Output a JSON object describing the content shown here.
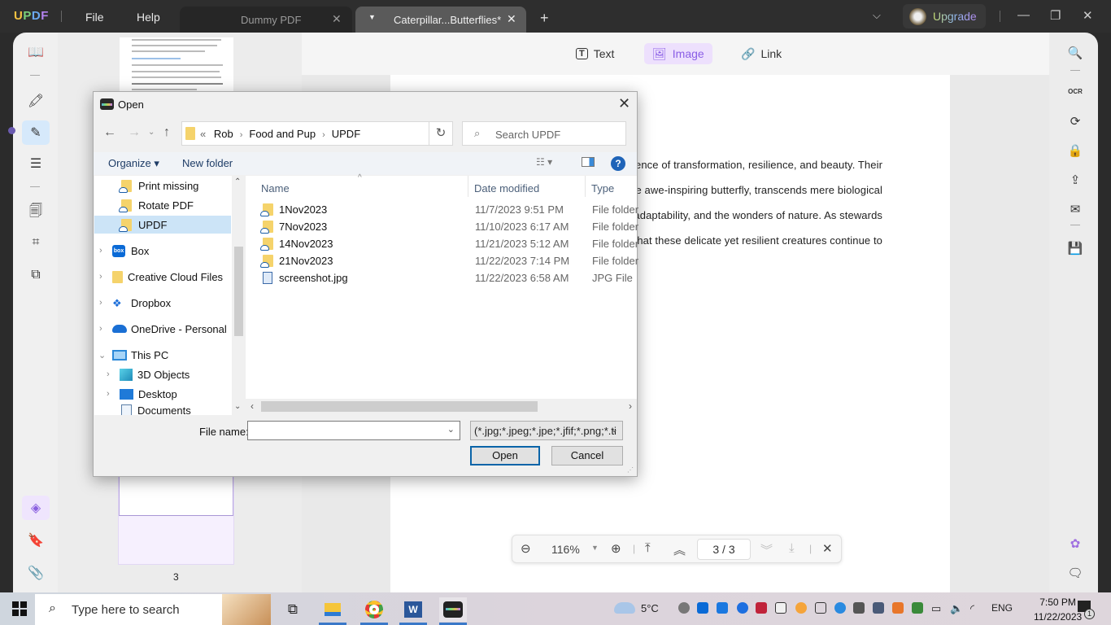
{
  "app": {
    "logo": {
      "u": "U",
      "p": "P",
      "d": "D",
      "f": "F"
    },
    "menu": [
      "File",
      "Help"
    ],
    "tabs": [
      {
        "label": "Dummy PDF",
        "active": false
      },
      {
        "label": "Caterpillar...Butterflies*",
        "active": true
      }
    ],
    "upgrade_label": "Upgrade",
    "colors": {
      "accent": "#8a5ee6",
      "titlebar": "#2e2e2e",
      "selected_tool_bg": "#ede0fd"
    }
  },
  "toolbar": {
    "tools": [
      {
        "label": "Text",
        "icon": "text-box-icon",
        "selected": false
      },
      {
        "label": "Image",
        "icon": "image-icon",
        "selected": true
      },
      {
        "label": "Link",
        "icon": "link-icon",
        "selected": false
      }
    ]
  },
  "thumbnails": {
    "page_label": "3"
  },
  "document": {
    "lines": [
      "essence of transformation, resilience, and beauty. Their",
      "to the awe-inspiring butterfly, transcends mere biological",
      "hope, adaptability, and the wonders of nature. As stewards",
      "sure that these delicate yet resilient creatures continue to"
    ]
  },
  "zoombar": {
    "zoom": "116%",
    "current_page": "3",
    "total_pages": "3",
    "page_display": "3 / 3"
  },
  "dialog": {
    "title": "Open",
    "breadcrumb_prefix": "«",
    "breadcrumb": [
      "Rob",
      "Food and Pup",
      "UPDF"
    ],
    "search_placeholder": "Search UPDF",
    "organize_label": "Organize ▾",
    "new_folder_label": "New folder",
    "help_label": "?",
    "nav_items": [
      {
        "label": "Print missing",
        "type": "folder-cloud",
        "selected": false
      },
      {
        "label": "Rotate PDF",
        "type": "folder-cloud",
        "selected": false
      },
      {
        "label": "UPDF",
        "type": "folder-cloud",
        "selected": true
      },
      {
        "label": "Box",
        "type": "box",
        "selected": false
      },
      {
        "label": "Creative Cloud Files",
        "type": "creative-cloud",
        "selected": false
      },
      {
        "label": "Dropbox",
        "type": "dropbox",
        "selected": false
      },
      {
        "label": "OneDrive - Personal",
        "type": "onedrive",
        "selected": false
      },
      {
        "label": "This PC",
        "type": "pc",
        "selected": false
      },
      {
        "label": "3D Objects",
        "type": "3d",
        "selected": false
      },
      {
        "label": "Desktop",
        "type": "desktop",
        "selected": false
      },
      {
        "label": "Documents",
        "type": "documents",
        "selected": false
      }
    ],
    "columns": {
      "name": "Name",
      "date": "Date modified",
      "type": "Type"
    },
    "files": [
      {
        "name": "1Nov2023",
        "date": "11/7/2023 9:51 PM",
        "type": "File folder",
        "kind": "folder"
      },
      {
        "name": "7Nov2023",
        "date": "11/10/2023 6:17 AM",
        "type": "File folder",
        "kind": "folder"
      },
      {
        "name": "14Nov2023",
        "date": "11/21/2023 5:12 AM",
        "type": "File folder",
        "kind": "folder"
      },
      {
        "name": "21Nov2023",
        "date": "11/22/2023 7:14 PM",
        "type": "File folder",
        "kind": "folder"
      },
      {
        "name": "screenshot.jpg",
        "date": "11/22/2023 6:58 AM",
        "type": "JPG File",
        "kind": "jpg"
      }
    ],
    "file_name_label": "File name:",
    "file_name_value": "",
    "file_type_value": "(*.jpg;*.jpeg;*.jpe;*.jfif;*.png;*.ti",
    "open_label": "Open",
    "cancel_label": "Cancel"
  },
  "taskbar": {
    "search_placeholder": "Type here to search",
    "weather": "5°C",
    "language": "ENG",
    "time": "7:50 PM",
    "date": "11/22/2023",
    "notification_count": "1"
  }
}
